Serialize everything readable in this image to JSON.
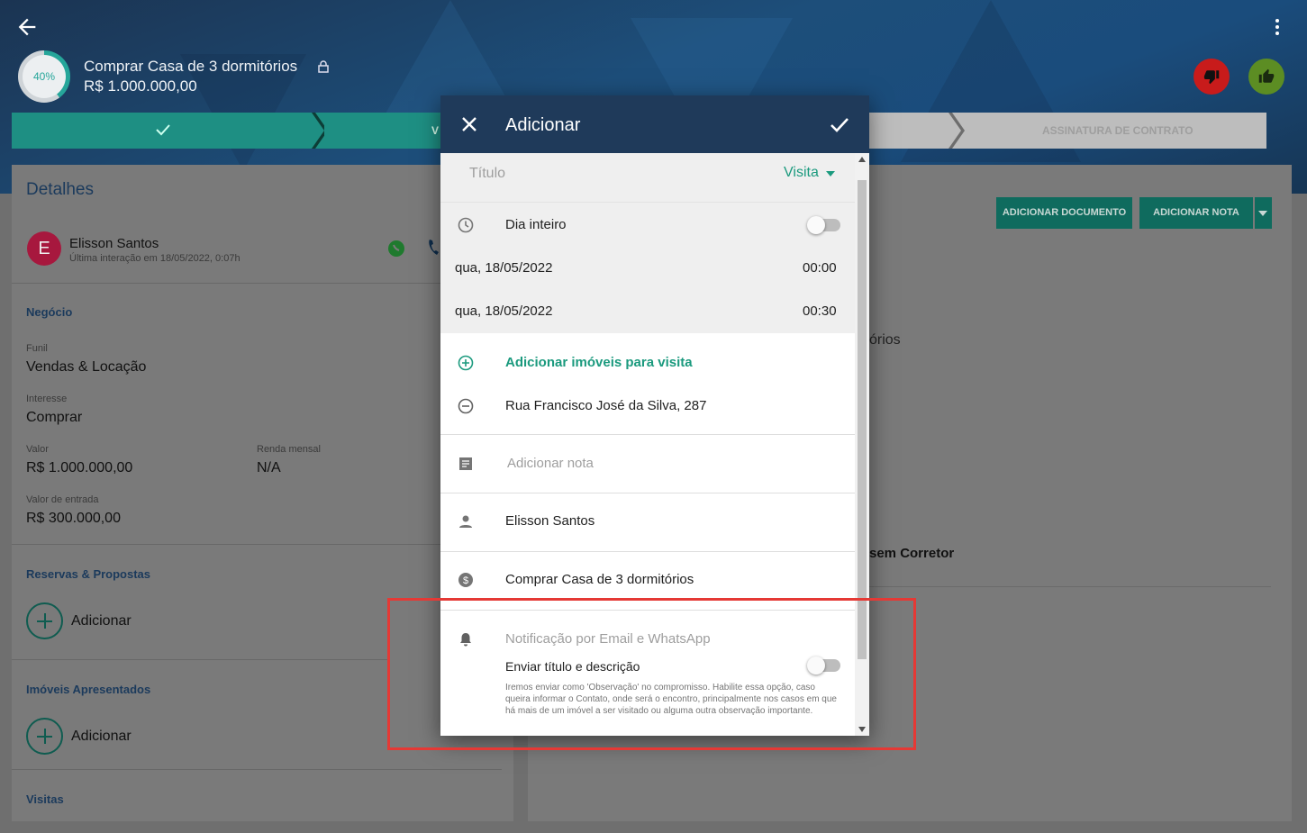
{
  "header": {
    "progress": "40%",
    "deal_title": "Comprar Casa de 3 dormitórios",
    "deal_value": "R$ 1.000.000,00"
  },
  "pipeline": {
    "stage_partial": "V",
    "stage_last": "ASSINATURA DE CONTRATO"
  },
  "details": {
    "title": "Detalhes",
    "contact_name": "Elisson Santos",
    "contact_initial": "E",
    "last_interaction": "Última interação em 18/05/2022, 0:07h",
    "business_header": "Negócio",
    "funil_label": "Funil",
    "funil_value": "Vendas & Locação",
    "interesse_label": "Interesse",
    "interesse_value": "Comprar",
    "valor_label": "Valor",
    "valor_value": "R$ 1.000.000,00",
    "renda_label": "Renda mensal",
    "renda_value": "N/A",
    "entrada_label": "Valor de entrada",
    "entrada_value": "R$ 300.000,00",
    "reservas_header": "Reservas & Propostas",
    "reservas_add": "Adicionar",
    "imoveis_header": "Imóveis Apresentados",
    "imoveis_add": "Adicionar",
    "visitas_header": "Visitas"
  },
  "right_panel": {
    "add_document": "ADICIONAR DOCUMENTO",
    "add_note": "ADICIONAR NOTA",
    "partial_text": "órios",
    "partial_bold": "sem Corretor"
  },
  "modal": {
    "title": "Adicionar",
    "titulo_placeholder": "Título",
    "type_value": "Visita",
    "all_day_label": "Dia inteiro",
    "start_date": "qua, 18/05/2022",
    "start_time": "00:00",
    "end_date": "qua, 18/05/2022",
    "end_time": "00:30",
    "add_properties": "Adicionar imóveis para visita",
    "property_address": "Rua Francisco José da Silva, 287",
    "note_placeholder": "Adicionar nota",
    "contact": "Elisson Santos",
    "deal": "Comprar Casa de 3 dormitórios",
    "notification_label": "Notificação por Email e WhatsApp",
    "send_label": "Enviar título e descrição",
    "help_text": "Iremos enviar como 'Observação' no compromisso. Habilite essa opção, caso queira informar o Contato, onde será o encontro, principalmente nos casos em que há mais de um imóvel a ser visitado ou alguma outra observação importante."
  },
  "colors": {
    "header_bg": "#1d4e7a",
    "accent_green": "#1b9a7e",
    "modal_header": "#1f3a5a",
    "highlight_red": "#e53935"
  }
}
